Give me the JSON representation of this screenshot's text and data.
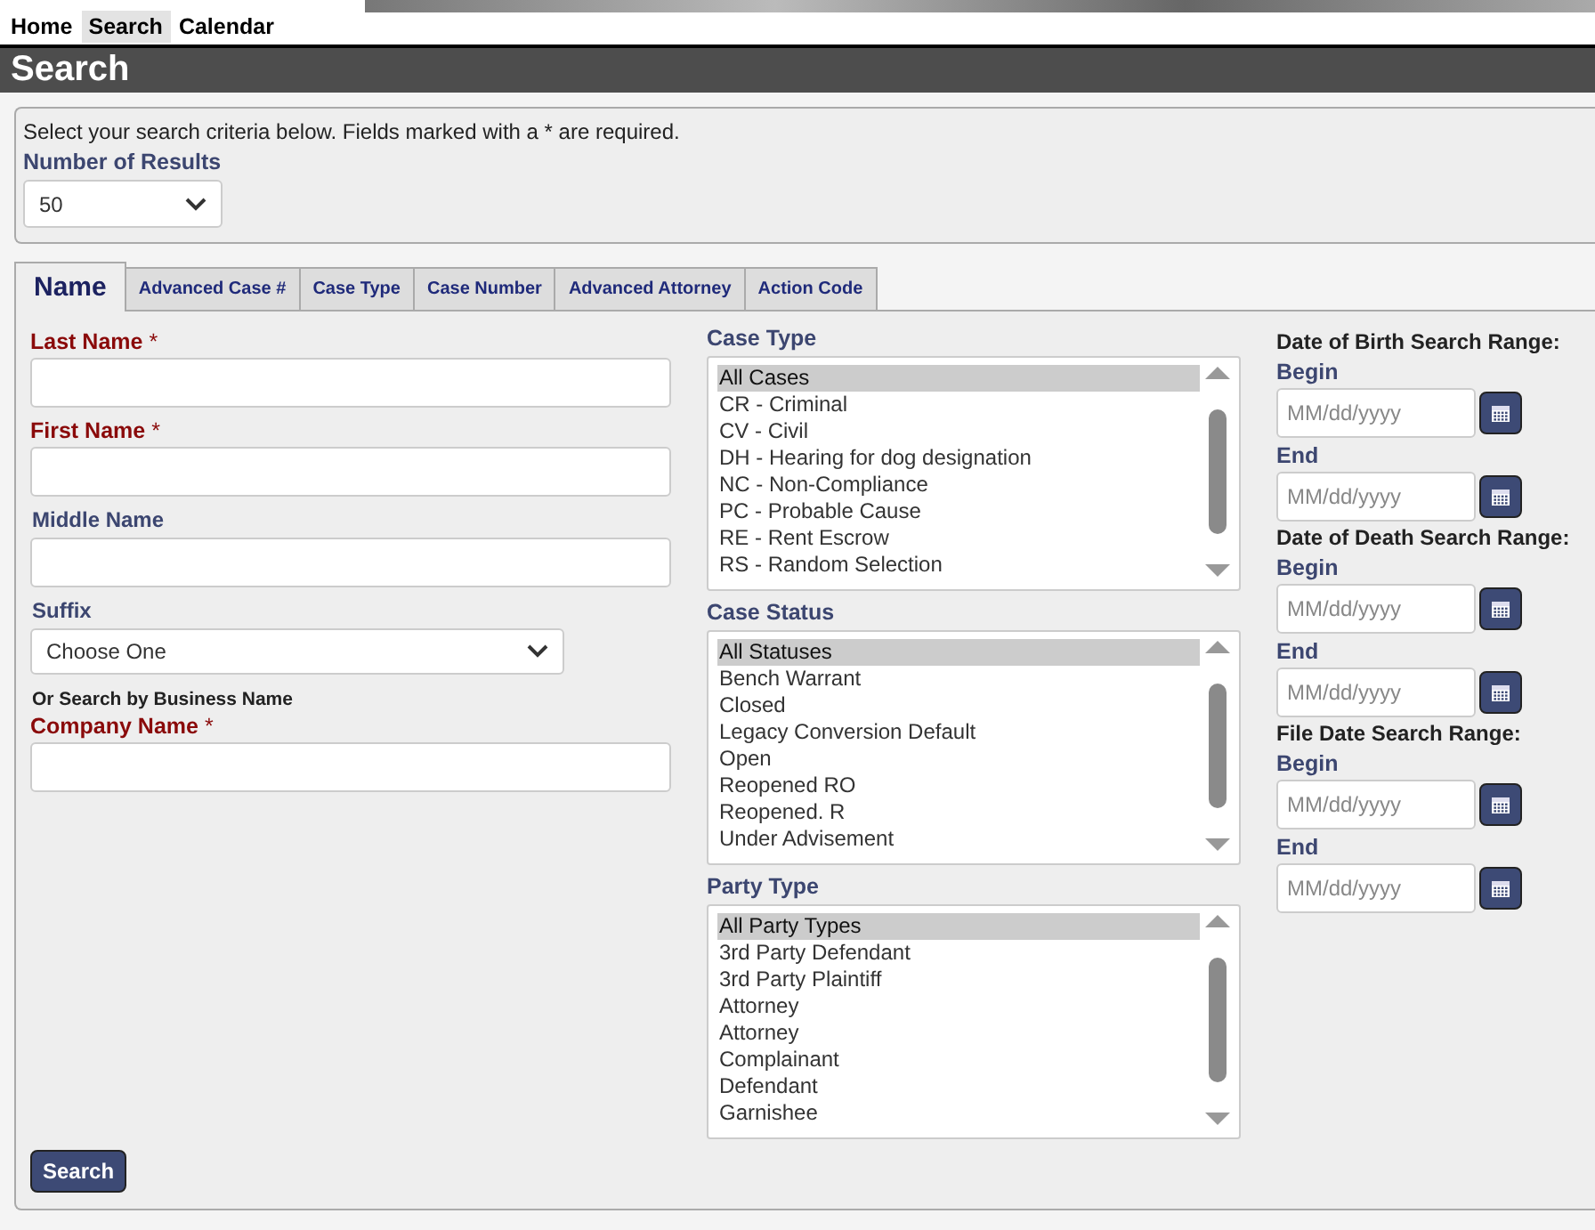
{
  "nav": [
    {
      "label": "Home",
      "selected": false
    },
    {
      "label": "Search",
      "selected": true
    },
    {
      "label": "Calendar",
      "selected": false
    }
  ],
  "page_title": "Search",
  "criteria": {
    "instructions": "Select your search criteria below. Fields marked with a * are required.",
    "results_label": "Number of Results",
    "results_value": "50"
  },
  "tabs": [
    {
      "label": "Name",
      "selected": true
    },
    {
      "label": "Advanced Case #",
      "selected": false
    },
    {
      "label": "Case Type",
      "selected": false
    },
    {
      "label": "Case Number",
      "selected": false
    },
    {
      "label": "Advanced Attorney",
      "selected": false
    },
    {
      "label": "Action Code",
      "selected": false
    }
  ],
  "name_form": [
    {
      "kind": "text",
      "label": "Last Name",
      "required": true,
      "required_mark": "*"
    },
    {
      "kind": "text",
      "label": "First Name",
      "required": true,
      "required_mark": "*"
    },
    {
      "kind": "text",
      "label": "Middle Name",
      "required": false
    },
    {
      "kind": "select",
      "label": "Suffix",
      "required": false,
      "value": "Choose One"
    },
    {
      "kind": "note",
      "label": "Or Search by Business Name"
    },
    {
      "kind": "text",
      "label": "Company Name",
      "required": true,
      "required_mark": "*"
    }
  ],
  "lists": [
    {
      "label": "Case Type",
      "items": [
        {
          "label": "All Cases",
          "selected": true
        },
        {
          "label": "CR - Criminal",
          "selected": false
        },
        {
          "label": "CV - Civil",
          "selected": false
        },
        {
          "label": "DH - Hearing for dog designation",
          "selected": false
        },
        {
          "label": "NC - Non-Compliance",
          "selected": false
        },
        {
          "label": "PC - Probable Cause",
          "selected": false
        },
        {
          "label": "RE - Rent Escrow",
          "selected": false
        },
        {
          "label": "RS - Random Selection",
          "selected": false
        }
      ]
    },
    {
      "label": "Case Status",
      "items": [
        {
          "label": "All Statuses",
          "selected": true
        },
        {
          "label": "Bench Warrant",
          "selected": false
        },
        {
          "label": "Closed",
          "selected": false
        },
        {
          "label": "Legacy Conversion Default",
          "selected": false
        },
        {
          "label": "Open",
          "selected": false
        },
        {
          "label": "Reopened RO",
          "selected": false
        },
        {
          "label": "Reopened. R",
          "selected": false
        },
        {
          "label": "Under Advisement",
          "selected": false
        }
      ]
    },
    {
      "label": "Party Type",
      "items": [
        {
          "label": "All Party Types",
          "selected": true
        },
        {
          "label": "3rd Party Defendant",
          "selected": false
        },
        {
          "label": "3rd Party Plaintiff",
          "selected": false
        },
        {
          "label": "Attorney",
          "selected": false
        },
        {
          "label": "Attorney",
          "selected": false
        },
        {
          "label": "Complainant",
          "selected": false
        },
        {
          "label": "Defendant",
          "selected": false
        },
        {
          "label": "Garnishee",
          "selected": false
        }
      ]
    }
  ],
  "date_ranges": [
    {
      "title": "Date of Birth Search Range:",
      "fields": [
        {
          "label": "Begin",
          "placeholder": "MM/dd/yyyy"
        },
        {
          "label": "End",
          "placeholder": "MM/dd/yyyy"
        }
      ]
    },
    {
      "title": "Date of Death Search Range:",
      "fields": [
        {
          "label": "Begin",
          "placeholder": "MM/dd/yyyy"
        },
        {
          "label": "End",
          "placeholder": "MM/dd/yyyy"
        }
      ]
    },
    {
      "title": "File Date Search Range:",
      "fields": [
        {
          "label": "Begin",
          "placeholder": "MM/dd/yyyy"
        },
        {
          "label": "End",
          "placeholder": "MM/dd/yyyy"
        }
      ]
    }
  ],
  "search_button": "Search"
}
